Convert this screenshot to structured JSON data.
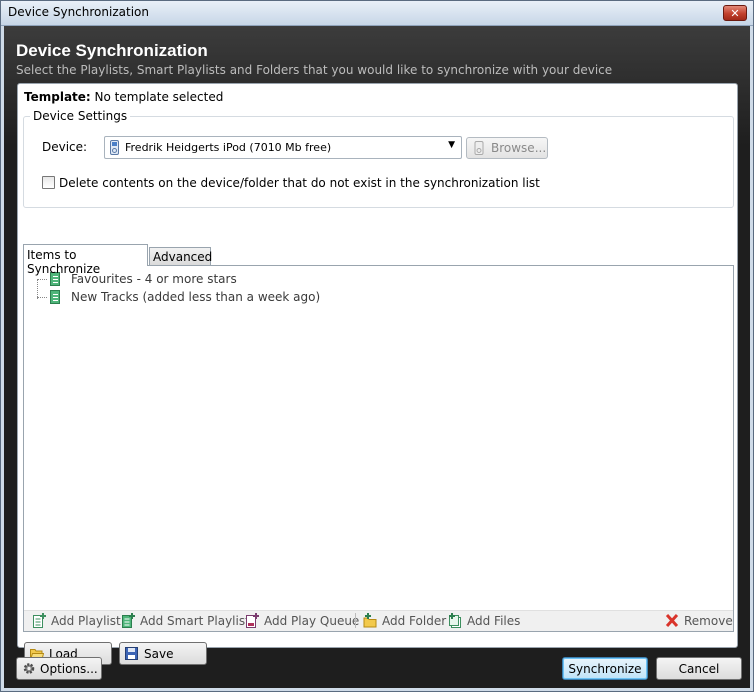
{
  "window": {
    "title": "Device Synchronization",
    "close_label": "✕"
  },
  "header": {
    "title": "Device Synchronization",
    "subtitle": "Select the Playlists, Smart Playlists and Folders that you would like to synchronize with your device"
  },
  "template": {
    "label": "Template:",
    "value": "No template selected"
  },
  "device_settings": {
    "legend": "Device Settings",
    "device_label": "Device:",
    "device_value": "Fredrik Heidgerts iPod (7010 Mb free)",
    "browse_label": "Browse...",
    "delete_checkbox_label": "Delete contents on the device/folder that do not exist in the synchronization list",
    "delete_checked": false
  },
  "tabs": [
    {
      "label": "Items to Synchronize",
      "active": true
    },
    {
      "label": "Advanced",
      "active": false
    }
  ],
  "items": [
    {
      "label": "Favourites - 4 or more stars",
      "icon": "smart-playlist-icon"
    },
    {
      "label": "New Tracks (added less than a week ago)",
      "icon": "smart-playlist-icon"
    }
  ],
  "toolbar": {
    "add_playlist": "Add Playlist",
    "add_smart_playlist": "Add Smart Playlist",
    "add_play_queue": "Add Play Queue",
    "add_folder": "Add Folder",
    "add_files": "Add Files",
    "remove": "Remove"
  },
  "panel_buttons": {
    "load": "Load",
    "save": "Save"
  },
  "footer": {
    "options": "Options...",
    "synchronize": "Synchronize",
    "cancel": "Cancel"
  },
  "colors": {
    "header_bg": "#1e1e1e",
    "accent_green": "#4fb57a",
    "remove_red": "#d9342b",
    "primary_blue": "#3c7fb1"
  }
}
